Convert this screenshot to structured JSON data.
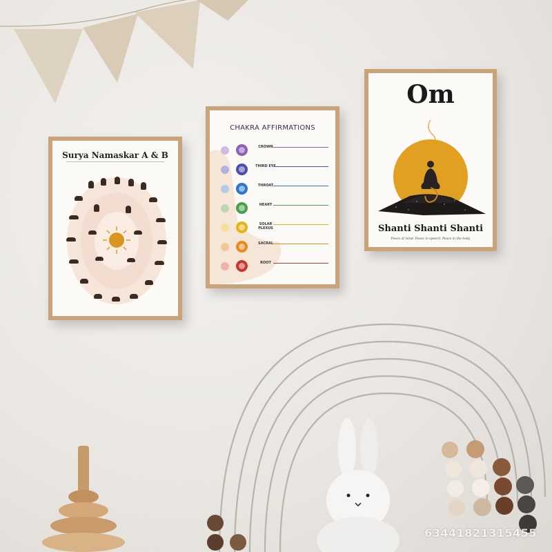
{
  "posters": {
    "surya": {
      "title": "Surya Namaskar A & B"
    },
    "chakra": {
      "title": "CHAKRA AFFIRMATIONS",
      "rows": [
        {
          "name": "CROWN",
          "color": "#8e5fb6"
        },
        {
          "name": "THIRD EYE",
          "color": "#4a4fb0"
        },
        {
          "name": "THROAT",
          "color": "#2f76c8"
        },
        {
          "name": "HEART",
          "color": "#4aa04a"
        },
        {
          "name": "SOLAR PLEXUS",
          "color": "#e6b416"
        },
        {
          "name": "SACRAL",
          "color": "#e98a1c"
        },
        {
          "name": "ROOT",
          "color": "#c8372d"
        }
      ]
    },
    "om": {
      "title": "Om",
      "heading": "Shanti Shanti Shanti",
      "caption": "Peace of mind. Peace in speech. Peace in the body",
      "sun_color": "#e0a021"
    }
  },
  "watermark": "63441821315455",
  "colors": {
    "frame": "#c9a47a",
    "wall": "#ece9e5"
  },
  "icons": [
    "bunting",
    "sun-icon",
    "meditation-figure-icon",
    "rainbow-decor",
    "bunny-plush",
    "stacking-toy",
    "bead-abacus"
  ]
}
